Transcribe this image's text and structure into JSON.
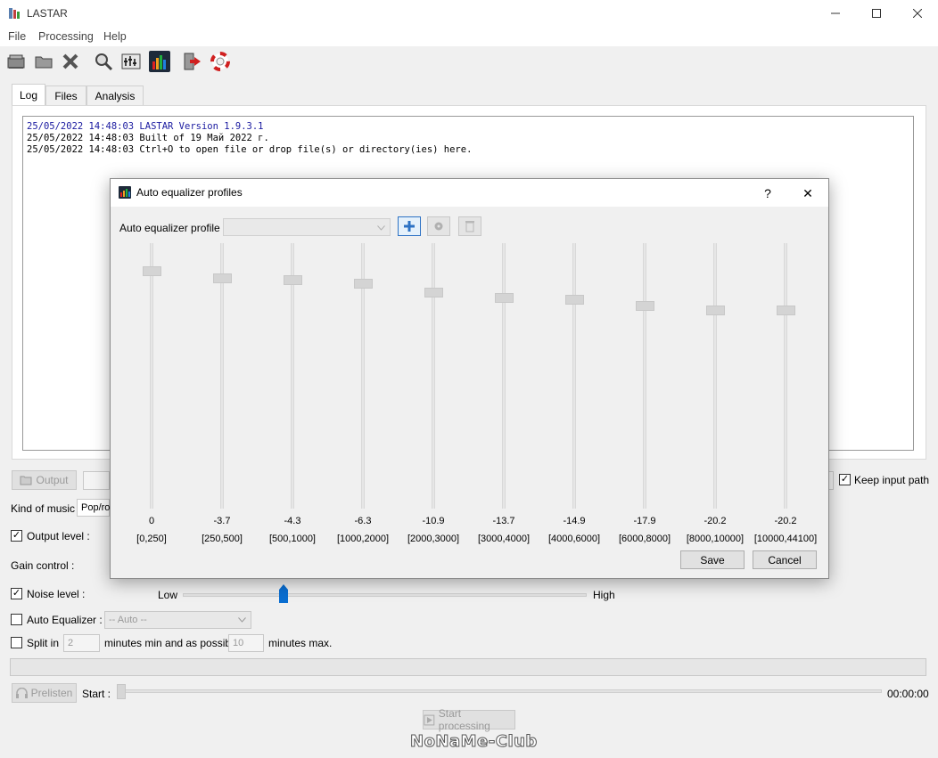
{
  "app": {
    "title": "LASTAR"
  },
  "menu": [
    "File",
    "Processing",
    "Help"
  ],
  "toolbar": {
    "icons": [
      "open-file-icon",
      "open-folder-icon",
      "close-icon",
      "search-icon",
      "equalizer-settings-icon",
      "auto-equalizer-icon",
      "exit-icon",
      "help-lifebuoy-icon"
    ]
  },
  "tabs": [
    "Log",
    "Files",
    "Analysis"
  ],
  "log": {
    "lines": [
      "25/05/2022 14:48:03 LASTAR Version 1.9.3.1",
      "25/05/2022 14:48:03 Built of 19 Май 2022 г.",
      "25/05/2022 14:48:03 Ctrl+O to open file or drop file(s) or directory(ies) here."
    ]
  },
  "main": {
    "output_button": "Output",
    "keep_input_path": "Keep input path",
    "keep_input_path_checked": true,
    "kind_of_music_label": "Kind of music :",
    "kind_of_music_value": "Pop/ro",
    "output_level_label": "Output level :",
    "output_level_checked": true,
    "gain_control_label": "Gain control :",
    "noise_level_label": "Noise level :",
    "noise_level_checked": true,
    "noise_low": "Low",
    "noise_high": "High",
    "noise_slider_value": 0.25,
    "auto_equalizer_label": "Auto Equalizer :",
    "auto_equalizer_checked": false,
    "auto_equalizer_value": "-- Auto --",
    "split_in_label": "Split in",
    "split_in_checked": false,
    "split_min_value": "2",
    "split_min_text": "minutes min and as possible",
    "split_max_value": "10",
    "split_max_text": "minutes max.",
    "prelisten_button": "Prelisten",
    "start_label": "Start :",
    "time": "00:00:00",
    "start_processing_button": "Start processing"
  },
  "dialog": {
    "title": "Auto equalizer profiles",
    "help": "?",
    "close": "✕",
    "profile_label": "Auto equalizer profile :",
    "profile_value": "",
    "bands": [
      {
        "value": "0",
        "range": "[0,250]"
      },
      {
        "value": "-3.7",
        "range": "[250,500]"
      },
      {
        "value": "-4.3",
        "range": "[500,1000]"
      },
      {
        "value": "-6.3",
        "range": "[1000,2000]"
      },
      {
        "value": "-10.9",
        "range": "[2000,3000]"
      },
      {
        "value": "-13.7",
        "range": "[3000,4000]"
      },
      {
        "value": "-14.9",
        "range": "[4000,6000]"
      },
      {
        "value": "-17.9",
        "range": "[6000,8000]"
      },
      {
        "value": "-20.2",
        "range": "[8000,10000]"
      },
      {
        "value": "-20.2",
        "range": "[10000,44100]"
      }
    ],
    "save_button": "Save",
    "cancel_button": "Cancel"
  },
  "watermark": "NoNaMe-Club"
}
